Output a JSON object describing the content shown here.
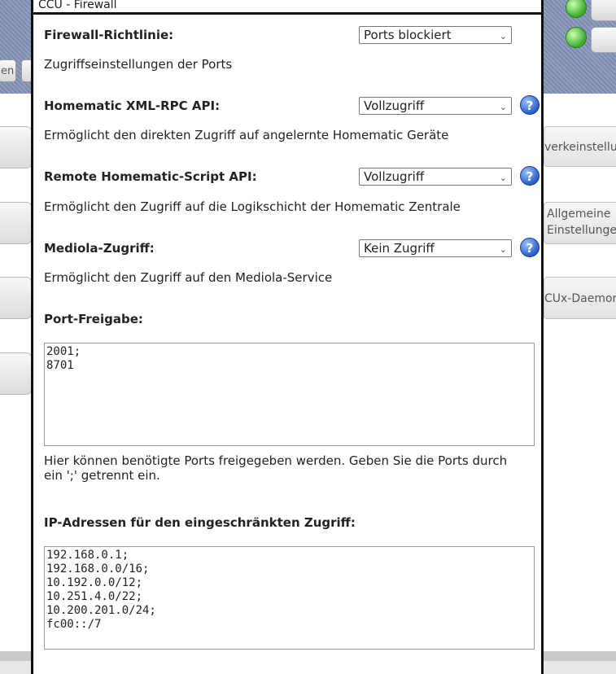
{
  "background": {
    "tab_left_1": "en",
    "tab_left_2": "",
    "right_cards": [
      "verkeinstellu",
      "Allgemeine",
      "Einstellungen",
      "CUx-Daemon"
    ]
  },
  "dialog": {
    "title": "CCU - Firewall",
    "sections": [
      {
        "label": "Firewall-Richtlinie:",
        "select": "Ports blockiert",
        "desc": "Zugriffseinstellungen der Ports",
        "help": false
      },
      {
        "label": "Homematic XML-RPC API:",
        "select": "Vollzugriff",
        "desc": "Ermöglicht den direkten Zugriff auf angelernte Homematic Geräte",
        "help": true
      },
      {
        "label": "Remote Homematic-Script API:",
        "select": "Vollzugriff",
        "desc": "Ermöglicht den Zugriff auf die Logikschicht der Homematic Zentrale",
        "help": true
      },
      {
        "label": "Mediola-Zugriff:",
        "select": "Kein Zugriff",
        "desc": "Ermöglicht den Zugriff auf den Mediola-Service",
        "help": true
      }
    ],
    "port": {
      "label": "Port-Freigabe:",
      "value": "2001;\n8701",
      "desc": "Hier können benötigte Ports freigegeben werden. Geben Sie die Ports durch ein ';' getrennt ein."
    },
    "ip": {
      "label": "IP-Adressen für den eingeschränkten Zugriff:",
      "value": "192.168.0.1;\n192.168.0.0/16;\n10.192.0.0/12;\n10.251.4.0/22;\n10.200.201.0/24;\nfc00::/7"
    },
    "help_glyph": "?",
    "chevron": "⌄"
  }
}
